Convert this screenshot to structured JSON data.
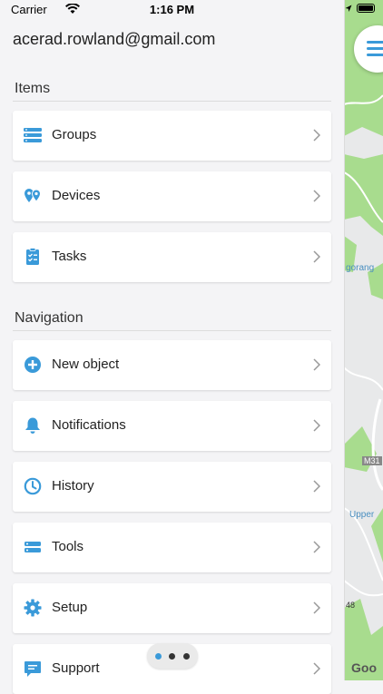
{
  "status_bar": {
    "carrier": "Carrier",
    "time": "1:16 PM"
  },
  "account": {
    "email": "acerad.rowland@gmail.com"
  },
  "sections": {
    "items": {
      "title": "Items",
      "entries": [
        {
          "label": "Groups",
          "icon": "groups-icon"
        },
        {
          "label": "Devices",
          "icon": "devices-icon"
        },
        {
          "label": "Tasks",
          "icon": "tasks-icon"
        }
      ]
    },
    "navigation": {
      "title": "Navigation",
      "entries": [
        {
          "label": "New object",
          "icon": "add-circle-icon"
        },
        {
          "label": "Notifications",
          "icon": "bell-icon"
        },
        {
          "label": "History",
          "icon": "clock-icon"
        },
        {
          "label": "Tools",
          "icon": "tools-icon"
        },
        {
          "label": "Setup",
          "icon": "gear-icon"
        },
        {
          "label": "Support",
          "icon": "chat-icon"
        }
      ]
    }
  },
  "map": {
    "labels": [
      "gorang",
      "M31",
      "Upper",
      "48"
    ],
    "attribution": "Goo"
  },
  "page_indicator": {
    "pages": 3,
    "active": 1
  },
  "colors": {
    "accent": "#3a9ad9",
    "map_green": "#a8dc8e",
    "background": "#f4f4f6"
  }
}
